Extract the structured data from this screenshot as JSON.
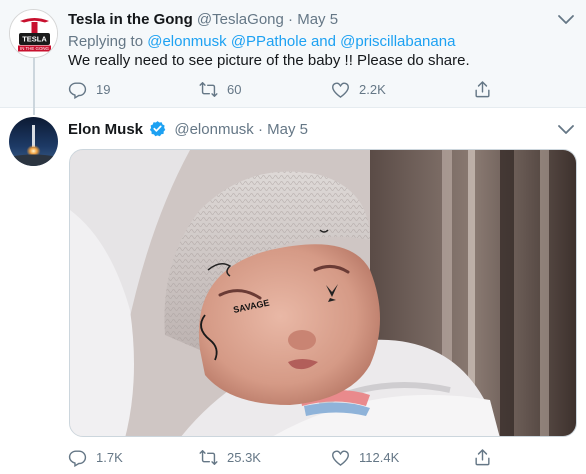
{
  "tweet1": {
    "display_name": "Tesla in the Gong",
    "handle": "@TeslaGong",
    "sep": "·",
    "date": "May 5",
    "reply_prefix": "Replying to",
    "mention1": "@elonmusk",
    "mention2": "@PPathole",
    "reply_and": "and",
    "mention3": "@priscillabanana",
    "text": "We really need to see picture of the baby !! Please do share.",
    "avatar_text": {
      "line1": "TESLA",
      "line2": "IN THE GONG"
    },
    "reply_count": "19",
    "retweet_count": "60",
    "like_count": "2.2K"
  },
  "tweet2": {
    "display_name": "Elon Musk",
    "handle": "@elonmusk",
    "sep": "·",
    "date": "May 5",
    "reply_count": "1.7K",
    "retweet_count": "25.3K",
    "like_count": "112.4K",
    "image_tattoo_text": "SAVAGE"
  },
  "colors": {
    "accent": "#1da1f2",
    "muted": "#657786",
    "thread_bg": "#f5f8fa"
  },
  "icons": [
    "reply-icon",
    "retweet-icon",
    "like-icon",
    "share-icon",
    "caret-down-icon",
    "verified-badge-icon"
  ]
}
